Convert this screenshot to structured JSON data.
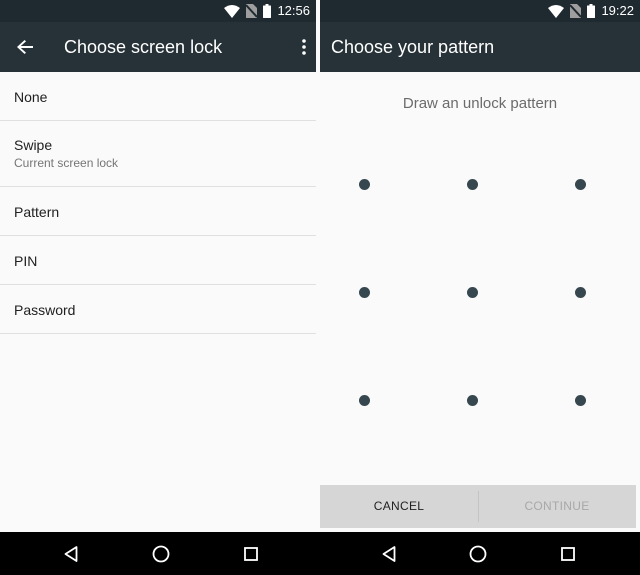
{
  "left_screen": {
    "status_bar": {
      "time": "12:56"
    },
    "toolbar": {
      "title": "Choose screen lock"
    },
    "lock_options": [
      {
        "title": "None",
        "summary": ""
      },
      {
        "title": "Swipe",
        "summary": "Current screen lock"
      },
      {
        "title": "Pattern",
        "summary": ""
      },
      {
        "title": "PIN",
        "summary": ""
      },
      {
        "title": "Password",
        "summary": ""
      }
    ]
  },
  "right_screen": {
    "status_bar": {
      "time": "19:22"
    },
    "toolbar": {
      "title": "Choose your pattern"
    },
    "instruction": "Draw an unlock pattern",
    "pattern_dots": 9,
    "buttons": {
      "cancel": "CANCEL",
      "continue": "CONTINUE"
    }
  },
  "icons": {
    "status": [
      "wifi-icon",
      "no-sim-icon",
      "battery-icon"
    ],
    "toolbar": [
      "back-arrow-icon",
      "overflow-menu-icon"
    ],
    "nav": [
      "nav-back-icon",
      "nav-home-icon",
      "nav-recents-icon"
    ]
  },
  "colors": {
    "status_bar": "#1f2a30",
    "toolbar": "#263238",
    "background": "#fafafa",
    "pattern_dot": "#37474f",
    "button_bar": "#d6d6d6",
    "disabled_text": "#a8a8a8"
  }
}
